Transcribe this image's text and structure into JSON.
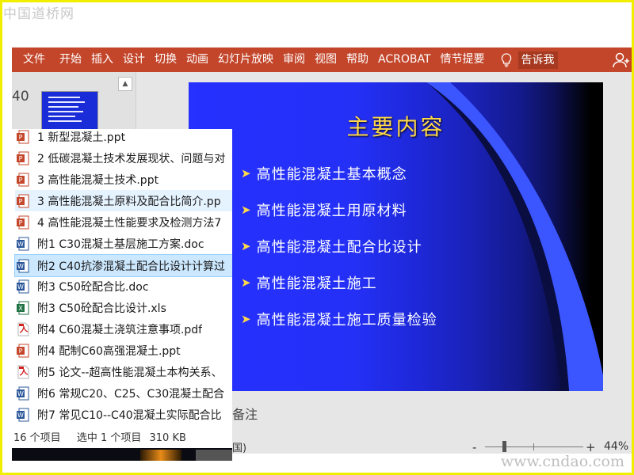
{
  "watermarks": {
    "top": "中国道桥网",
    "bottom": "www.cndao.com"
  },
  "ribbon": {
    "tabs": [
      "文件",
      "开始",
      "插入",
      "设计",
      "切换",
      "动画",
      "幻灯片放映",
      "审阅",
      "视图",
      "帮助",
      "ACROBAT",
      "情节提要"
    ],
    "tell_me": "告诉我"
  },
  "thumbnails": {
    "slide_number": "40"
  },
  "slide": {
    "title": "主要内容",
    "bullets": [
      "高性能混凝土基本概念",
      "高性能混凝土用原材料",
      "高性能混凝土配合比设计",
      "高性能混凝土施工",
      "高性能混凝土施工质量检验"
    ]
  },
  "notes_label": "备注",
  "status_bar": {
    "left_fragment": "国)",
    "minus": "-",
    "plus": "+",
    "zoom": "44%"
  },
  "files": [
    {
      "name": "1 新型混凝土.ppt",
      "type": "ppt"
    },
    {
      "name": "2 低碳混凝土技术发展现状、问题与对",
      "type": "ppt"
    },
    {
      "name": "3 高性能混凝土技术.ppt",
      "type": "ppt"
    },
    {
      "name": "3 高性能混凝土原料及配合比简介.pp",
      "type": "ppt"
    },
    {
      "name": "4 高性能混凝土性能要求及检测方法7",
      "type": "ppt"
    },
    {
      "name": "附1 C30混凝土基层施工方案.doc",
      "type": "doc"
    },
    {
      "name": "附2 C40抗渗混凝土配合比设计计算过",
      "type": "doc"
    },
    {
      "name": "附3 C50砼配合比.doc",
      "type": "doc"
    },
    {
      "name": "附3 C50砼配合比设计.xls",
      "type": "xls"
    },
    {
      "name": "附4 C60混凝土浇筑注意事项.pdf",
      "type": "pdf"
    },
    {
      "name": "附4 配制C60高强混凝土.ppt",
      "type": "ppt"
    },
    {
      "name": "附5 论文--超高性能混凝土本构关系、",
      "type": "pdf"
    },
    {
      "name": "附6 常规C20、C25、C30混凝土配合",
      "type": "doc"
    },
    {
      "name": "附7 常见C10--C40混凝土实际配合比",
      "type": "doc"
    }
  ],
  "file_status": {
    "count": "16 个项目",
    "selected": "选中 1 个项目",
    "size": "310 KB"
  },
  "colors": {
    "ribbon": "#c3462b",
    "slide_blue": "#2630ff",
    "title_yellow": "#ffd84a",
    "frame": "#f2ee00"
  }
}
